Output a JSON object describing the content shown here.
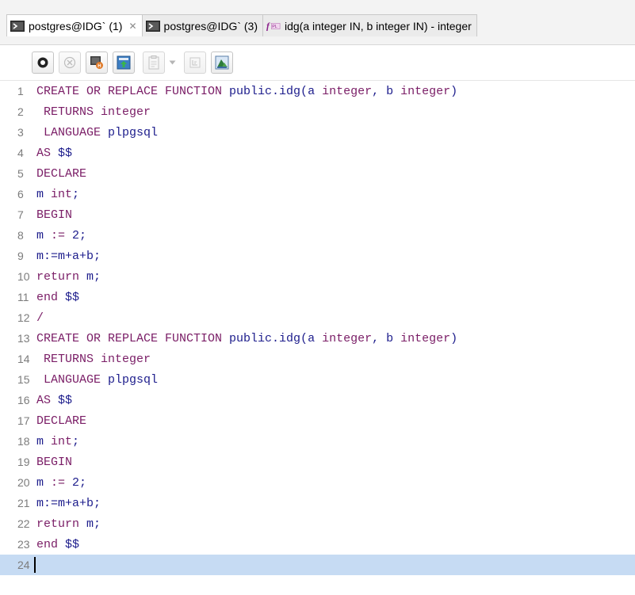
{
  "tabs": [
    {
      "label": "postgres@IDG` (1)",
      "icon": "sql-editor-icon",
      "active": true,
      "closable": true
    },
    {
      "label": "postgres@IDG` (3)",
      "icon": "sql-editor-icon",
      "active": false,
      "closable": false
    },
    {
      "label": "idg(a integer IN, b integer IN) - integer",
      "icon": "plpgsql-function-icon",
      "active": false,
      "closable": false
    }
  ],
  "tab_close_glyph": "✕",
  "toolbar": {
    "buttons": [
      "execute-icon",
      "cancel-icon",
      "explain-icon",
      "commit-icon",
      "format-icon",
      "dropdown-arrow-icon",
      "align-icon",
      "chart-icon"
    ]
  },
  "editor": {
    "current_line": 24,
    "lines": [
      {
        "n": "1",
        "tokens": [
          {
            "t": "CREATE OR REPLACE FUNCTION ",
            "k": "kw"
          },
          {
            "t": "public.idg(a ",
            "k": "fn"
          },
          {
            "t": "integer",
            "k": "kw"
          },
          {
            "t": ", b ",
            "k": "fn"
          },
          {
            "t": "integer",
            "k": "kw"
          },
          {
            "t": ")",
            "k": "fn"
          }
        ]
      },
      {
        "n": "2",
        "tokens": [
          {
            "t": " RETURNS ",
            "k": "kw"
          },
          {
            "t": "integer",
            "k": "kw"
          }
        ]
      },
      {
        "n": "3",
        "tokens": [
          {
            "t": " LANGUAGE ",
            "k": "kw"
          },
          {
            "t": "plpgsql",
            "k": "fn"
          }
        ]
      },
      {
        "n": "4",
        "tokens": [
          {
            "t": "AS ",
            "k": "kw"
          },
          {
            "t": "$$",
            "k": "fn"
          }
        ]
      },
      {
        "n": "5",
        "tokens": [
          {
            "t": "DECLARE",
            "k": "kw"
          }
        ]
      },
      {
        "n": "6",
        "tokens": [
          {
            "t": "m ",
            "k": "fn"
          },
          {
            "t": "int",
            "k": "kw"
          },
          {
            "t": ";",
            "k": "fn"
          }
        ]
      },
      {
        "n": "7",
        "tokens": [
          {
            "t": "BEGIN",
            "k": "kw"
          }
        ]
      },
      {
        "n": "8",
        "tokens": [
          {
            "t": "m ",
            "k": "fn"
          },
          {
            "t": ":=",
            "k": "kw"
          },
          {
            "t": " 2;",
            "k": "fn"
          }
        ]
      },
      {
        "n": "9",
        "tokens": [
          {
            "t": "m:=m+a+b;",
            "k": "fn"
          }
        ]
      },
      {
        "n": "10",
        "tokens": [
          {
            "t": "return",
            "k": "kw"
          },
          {
            "t": " m;",
            "k": "fn"
          }
        ]
      },
      {
        "n": "11",
        "tokens": [
          {
            "t": "end ",
            "k": "kw"
          },
          {
            "t": "$$",
            "k": "fn"
          }
        ]
      },
      {
        "n": "12",
        "tokens": [
          {
            "t": "/",
            "k": "kw"
          }
        ]
      },
      {
        "n": "13",
        "tokens": [
          {
            "t": "CREATE OR REPLACE FUNCTION ",
            "k": "kw"
          },
          {
            "t": "public.idg(a ",
            "k": "fn"
          },
          {
            "t": "integer",
            "k": "kw"
          },
          {
            "t": ", b ",
            "k": "fn"
          },
          {
            "t": "integer",
            "k": "kw"
          },
          {
            "t": ")",
            "k": "fn"
          }
        ]
      },
      {
        "n": "14",
        "tokens": [
          {
            "t": " RETURNS ",
            "k": "kw"
          },
          {
            "t": "integer",
            "k": "kw"
          }
        ]
      },
      {
        "n": "15",
        "tokens": [
          {
            "t": " LANGUAGE ",
            "k": "kw"
          },
          {
            "t": "plpgsql",
            "k": "fn"
          }
        ]
      },
      {
        "n": "16",
        "tokens": [
          {
            "t": "AS ",
            "k": "kw"
          },
          {
            "t": "$$",
            "k": "fn"
          }
        ]
      },
      {
        "n": "17",
        "tokens": [
          {
            "t": "DECLARE",
            "k": "kw"
          }
        ]
      },
      {
        "n": "18",
        "tokens": [
          {
            "t": "m ",
            "k": "fn"
          },
          {
            "t": "int",
            "k": "kw"
          },
          {
            "t": ";",
            "k": "fn"
          }
        ]
      },
      {
        "n": "19",
        "tokens": [
          {
            "t": "BEGIN",
            "k": "kw"
          }
        ]
      },
      {
        "n": "20",
        "tokens": [
          {
            "t": "m ",
            "k": "fn"
          },
          {
            "t": ":=",
            "k": "kw"
          },
          {
            "t": " 2;",
            "k": "fn"
          }
        ]
      },
      {
        "n": "21",
        "tokens": [
          {
            "t": "m:=m+a+b;",
            "k": "fn"
          }
        ]
      },
      {
        "n": "22",
        "tokens": [
          {
            "t": "return",
            "k": "kw"
          },
          {
            "t": " m;",
            "k": "fn"
          }
        ]
      },
      {
        "n": "23",
        "tokens": [
          {
            "t": "end ",
            "k": "kw"
          },
          {
            "t": "$$",
            "k": "fn"
          }
        ]
      },
      {
        "n": "24",
        "tokens": []
      }
    ]
  },
  "colors": {
    "keyword": "#7a1d66",
    "identifier": "#1d1d8c",
    "line_number": "#7c7c7c",
    "current_line_bg": "#c6dbf3"
  }
}
